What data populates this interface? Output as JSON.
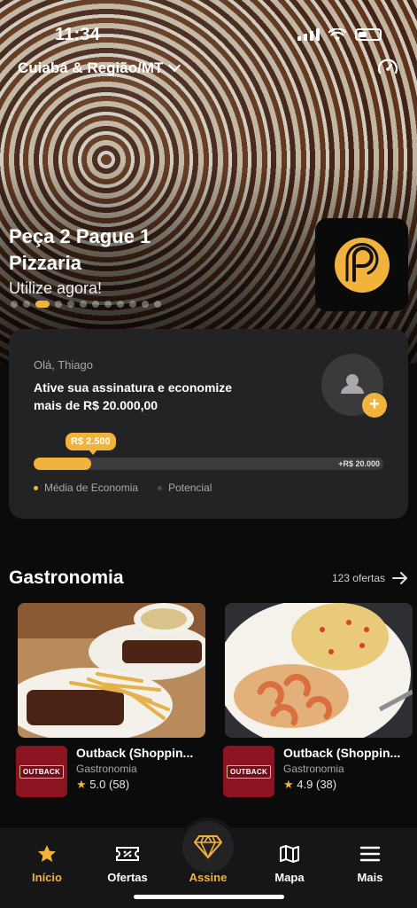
{
  "status_bar": {
    "time": "11:34"
  },
  "header": {
    "location": "Cuiabá & Região/MT"
  },
  "banner": {
    "title_line1": "Peça 2 Pague 1",
    "title_line2": "Pizzaria",
    "subtitle": "Utilize agora!",
    "dot_count": 12,
    "active_dot_index": 2
  },
  "subscription": {
    "greeting": "Olá, Thiago",
    "headline_line1": "Ative sua assinatura e economize",
    "headline_line2": "mais de  R$ 20.000,00",
    "avg_savings_label": "R$ 2.500",
    "potential_label": "+R$ 20.000",
    "progress_fraction": 0.165,
    "legend": [
      {
        "label": "Média de Economia",
        "color": "#f2b33d"
      },
      {
        "label": "Potencial",
        "color": "#4a4a4e"
      }
    ]
  },
  "section": {
    "title": "Gastronomia",
    "see_all": "123 ofertas"
  },
  "offers": [
    {
      "name": "Outback (Shoppin...",
      "category": "Gastronomia",
      "rating": "5.0",
      "reviews": "(58)",
      "brand": "OUTBACK"
    },
    {
      "name": "Outback (Shoppin...",
      "category": "Gastronomia",
      "rating": "4.9",
      "reviews": "(38)",
      "brand": "OUTBACK"
    }
  ],
  "tabs": [
    {
      "label": "Início",
      "icon": "star-icon"
    },
    {
      "label": "Ofertas",
      "icon": "ticket-icon"
    },
    {
      "label": "Assine",
      "icon": "diamond-icon"
    },
    {
      "label": "Mapa",
      "icon": "map-icon"
    },
    {
      "label": "Mais",
      "icon": "menu-icon"
    }
  ],
  "colors": {
    "accent": "#f2b33d",
    "card": "#232325",
    "background": "#0b0b0c",
    "brand_outback": "#8c1420"
  }
}
